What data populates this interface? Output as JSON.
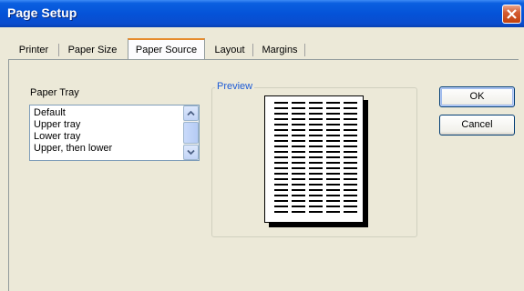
{
  "window": {
    "title": "Page Setup"
  },
  "tabs": [
    {
      "label": "Printer"
    },
    {
      "label": "Paper Size"
    },
    {
      "label": "Paper Source",
      "active": true
    },
    {
      "label": "Layout"
    },
    {
      "label": "Margins"
    }
  ],
  "paper_tray": {
    "label": "Paper Tray",
    "options": [
      "Default",
      "Upper tray",
      "Lower tray",
      "Upper, then lower"
    ]
  },
  "preview": {
    "label": "Preview"
  },
  "buttons": {
    "ok": "OK",
    "cancel": "Cancel"
  },
  "icons": {
    "close": "close-icon",
    "scroll_up": "chevron-up-icon",
    "scroll_down": "chevron-down-icon"
  },
  "colors": {
    "title_bar": "#0553d8",
    "close_button": "#c2410d",
    "group_title": "#1d5bd6",
    "dialog_bg": "#ece9d8"
  }
}
